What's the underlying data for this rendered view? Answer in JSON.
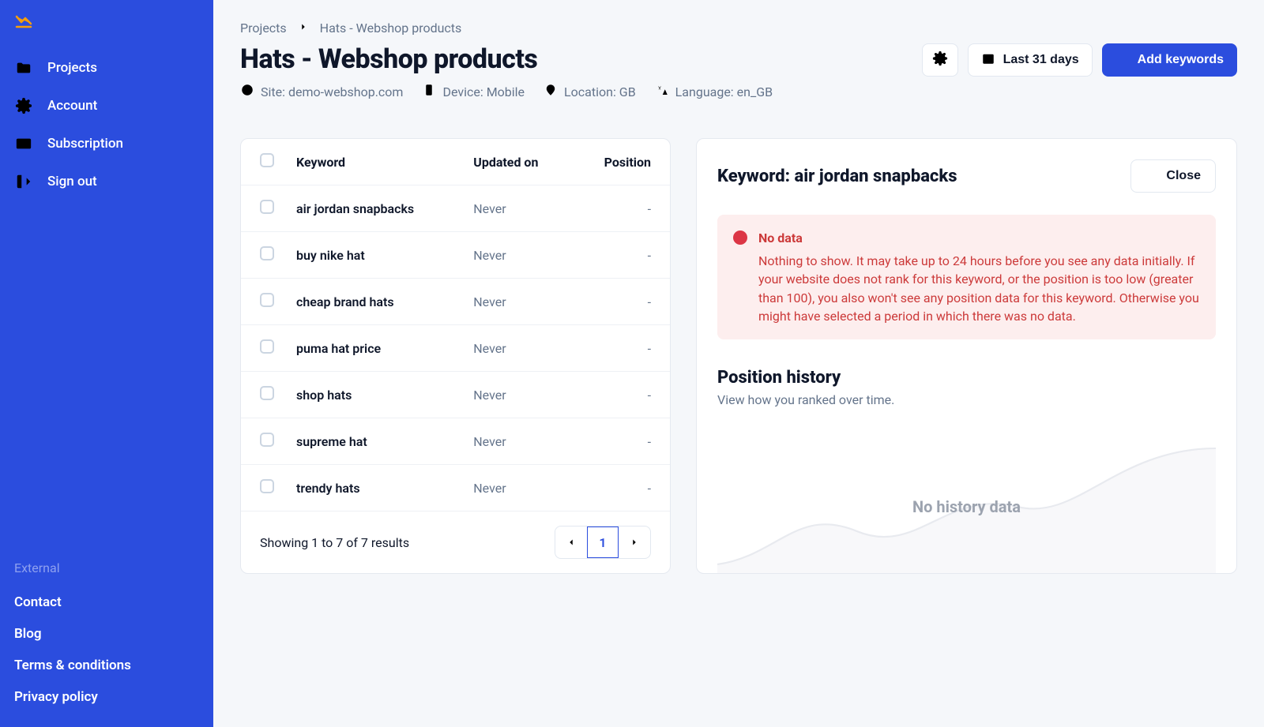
{
  "sidebar": {
    "nav": [
      {
        "label": "Projects"
      },
      {
        "label": "Account"
      },
      {
        "label": "Subscription"
      },
      {
        "label": "Sign out"
      }
    ],
    "external_label": "External",
    "external_links": [
      {
        "label": "Contact"
      },
      {
        "label": "Blog"
      },
      {
        "label": "Terms & conditions"
      },
      {
        "label": "Privacy policy"
      }
    ]
  },
  "breadcrumb": {
    "root": "Projects",
    "current": "Hats - Webshop products"
  },
  "page": {
    "title": "Hats - Webshop products",
    "meta": {
      "site": "Site: demo-webshop.com",
      "device": "Device: Mobile",
      "location": "Location: GB",
      "language": "Language: en_GB"
    }
  },
  "actions": {
    "date_range": "Last 31 days",
    "add_keywords": "Add keywords"
  },
  "table": {
    "columns": {
      "keyword": "Keyword",
      "updated_on": "Updated on",
      "position": "Position"
    },
    "rows": [
      {
        "keyword": "air jordan snapbacks",
        "updated_on": "Never",
        "position": "-"
      },
      {
        "keyword": "buy nike hat",
        "updated_on": "Never",
        "position": "-"
      },
      {
        "keyword": "cheap brand hats",
        "updated_on": "Never",
        "position": "-"
      },
      {
        "keyword": "puma hat price",
        "updated_on": "Never",
        "position": "-"
      },
      {
        "keyword": "shop hats",
        "updated_on": "Never",
        "position": "-"
      },
      {
        "keyword": "supreme hat",
        "updated_on": "Never",
        "position": "-"
      },
      {
        "keyword": "trendy hats",
        "updated_on": "Never",
        "position": "-"
      }
    ],
    "footer": "Showing 1 to 7 of 7 results",
    "pagination": {
      "current": "1"
    }
  },
  "detail": {
    "title_prefix": "Keyword: ",
    "title_keyword": "air jordan snapbacks",
    "close": "Close",
    "alert": {
      "title": "No data",
      "body": "Nothing to show. It may take up to 24 hours before you see any data initially. If your website does not rank for this keyword, or the position is too low (greater than 100), you also won't see any position data for this keyword. Otherwise you might have selected a period in which there was no data."
    },
    "history": {
      "title": "Position history",
      "subtitle": "View how you ranked over time.",
      "empty": "No history data"
    }
  }
}
